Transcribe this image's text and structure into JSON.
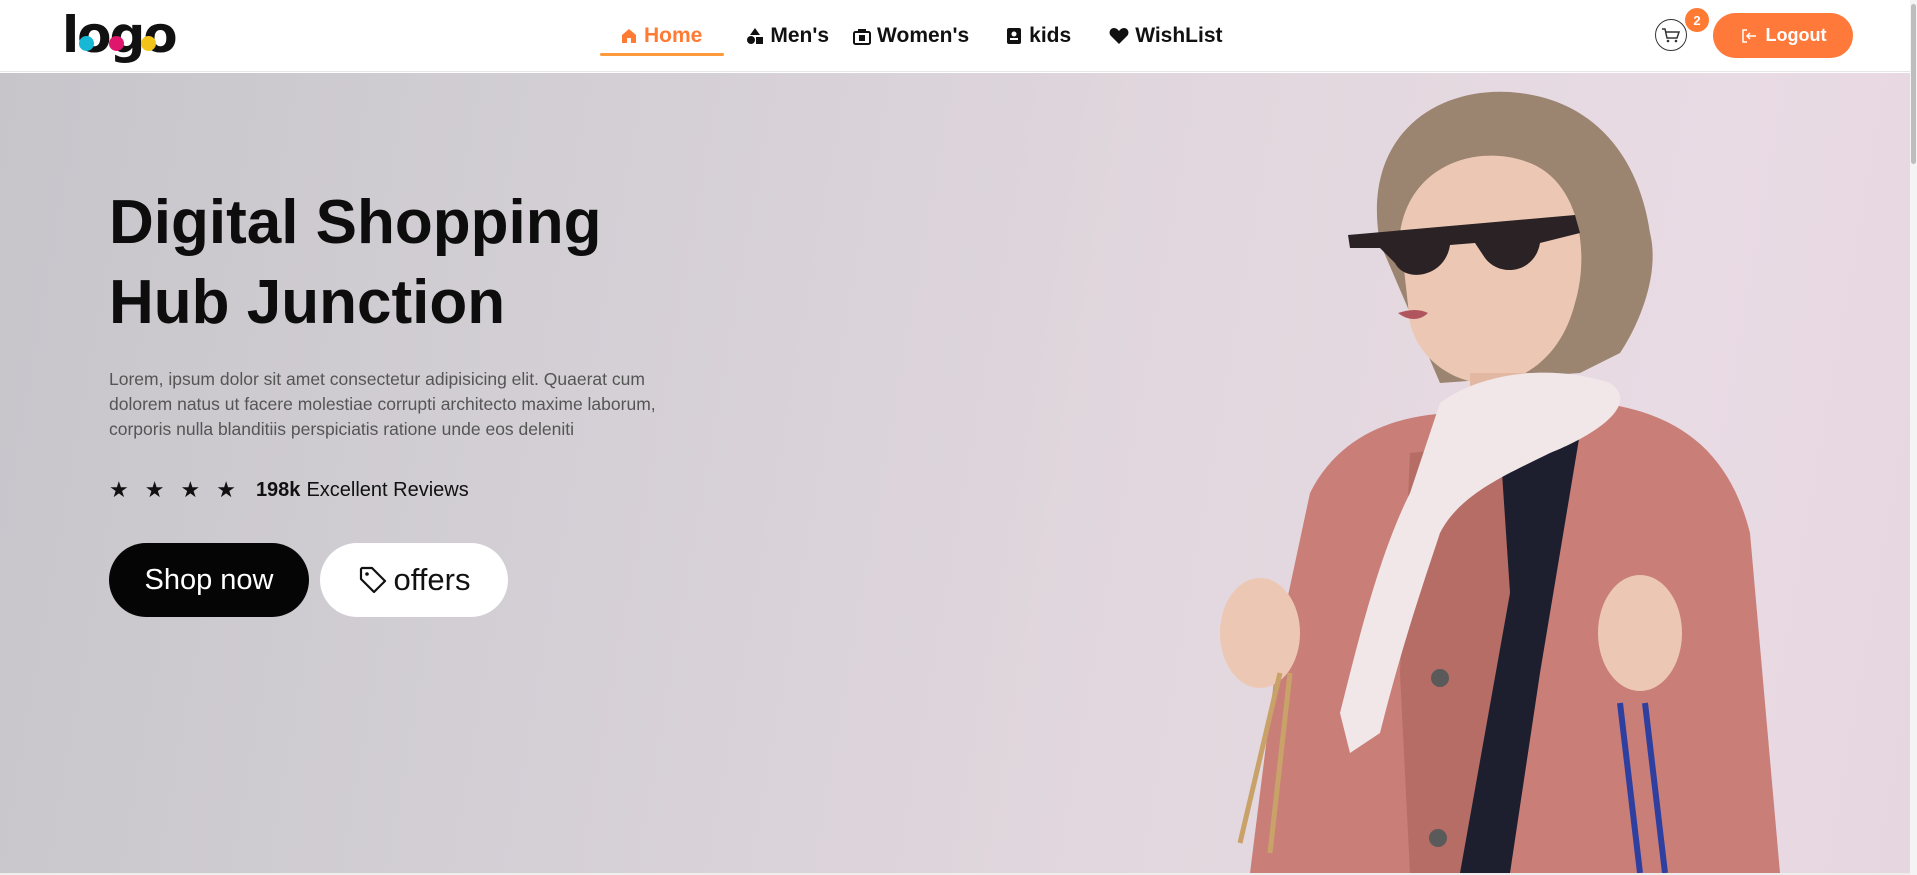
{
  "header": {
    "logo_text": "logo",
    "nav": [
      {
        "label": "Home",
        "icon": "home-icon",
        "active": true
      },
      {
        "label": "Men's",
        "icon": "shapes-icon",
        "active": false
      },
      {
        "label": "Women's",
        "icon": "shopping-bag-icon",
        "active": false
      },
      {
        "label": "kids",
        "icon": "contact-book-icon",
        "active": false
      },
      {
        "label": "WishList",
        "icon": "heart-icon",
        "active": false
      }
    ],
    "cart_count": "2",
    "logout_label": "Logout"
  },
  "hero": {
    "title_line1": "Digital Shopping",
    "title_line2": "Hub Junction",
    "description": "Lorem, ipsum dolor sit amet consectetur adipisicing elit. Quaerat cum dolorem natus ut facere molestiae corrupti architecto maxime laborum, corporis nulla blanditiis perspiciatis ratione unde eos deleniti",
    "rating_stars": 4,
    "review_count": "198k",
    "review_text": "Excellent Reviews",
    "shop_label": "Shop now",
    "offers_label": "offers"
  },
  "colors": {
    "accent": "#ff7a33",
    "logo_dots": [
      "#16b8d6",
      "#e0156c",
      "#f2c318"
    ]
  }
}
